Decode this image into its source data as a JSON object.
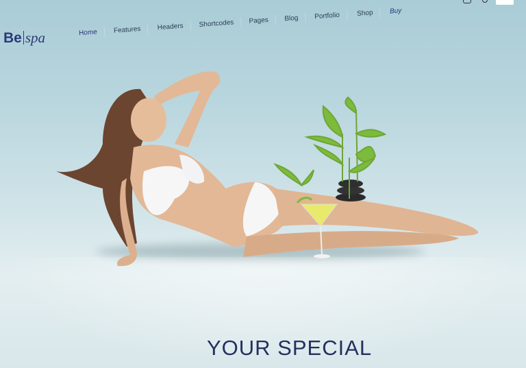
{
  "brand": {
    "part1": "Be",
    "part2": "spa"
  },
  "nav": {
    "items": [
      {
        "label": "Home"
      },
      {
        "label": "Features"
      },
      {
        "label": "Headers"
      },
      {
        "label": "Shortcodes"
      },
      {
        "label": "Pages"
      },
      {
        "label": "Blog"
      },
      {
        "label": "Portfolio"
      },
      {
        "label": "Shop"
      },
      {
        "label": "Buy"
      }
    ]
  },
  "hero": {
    "headline": "YOUR SPECIAL"
  },
  "colors": {
    "brand": "#2b3a78",
    "headline": "#24305e",
    "sky": "#a9ccd6"
  },
  "icons": [
    "cart-icon",
    "search-icon"
  ]
}
